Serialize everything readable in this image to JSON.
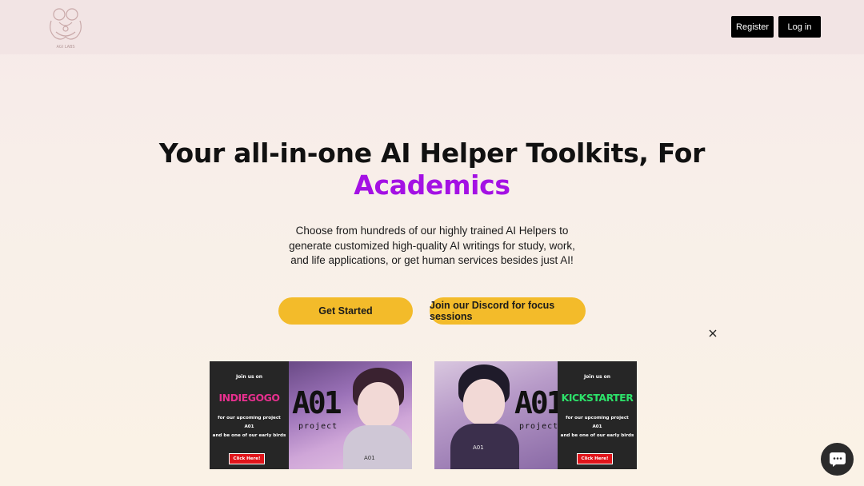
{
  "header": {
    "logo_text": "AGI LABS",
    "register_label": "Register",
    "login_label": "Log in"
  },
  "hero": {
    "headline": "Your all-in-one AI Helper Toolkits, For",
    "headline_accent": "Academics",
    "accent_color": "#a411e4",
    "description": "Choose from hundreds of our highly trained AI Helpers to generate customized high-quality AI writings for study, work, and life applications, or get human services besides just AI!",
    "get_started_label": "Get Started",
    "discord_label": "Join our Discord for focus sessions",
    "cta_color": "#f3bb2a"
  },
  "banners": [
    {
      "join_text": "Join us on",
      "platform": "INDIEGOGO",
      "promo_line1": "for our upcoming project",
      "promo_line2": "A01",
      "promo_line3": "and be one of our early birds",
      "click_label": "Click Here!",
      "art_title": "A01",
      "art_sub": "project",
      "art_tag": "A01"
    },
    {
      "join_text": "Join us on",
      "platform": "KICKSTARTER",
      "promo_line1": "for our upcoming project",
      "promo_line2": "A01",
      "promo_line3": "and be one of our early birds",
      "click_label": "Click Here!",
      "art_title": "A01",
      "art_sub": "project",
      "art_tag": "A01"
    }
  ],
  "icons": {
    "close": "close-icon",
    "chat": "chat-icon",
    "logo": "logo-icon"
  }
}
